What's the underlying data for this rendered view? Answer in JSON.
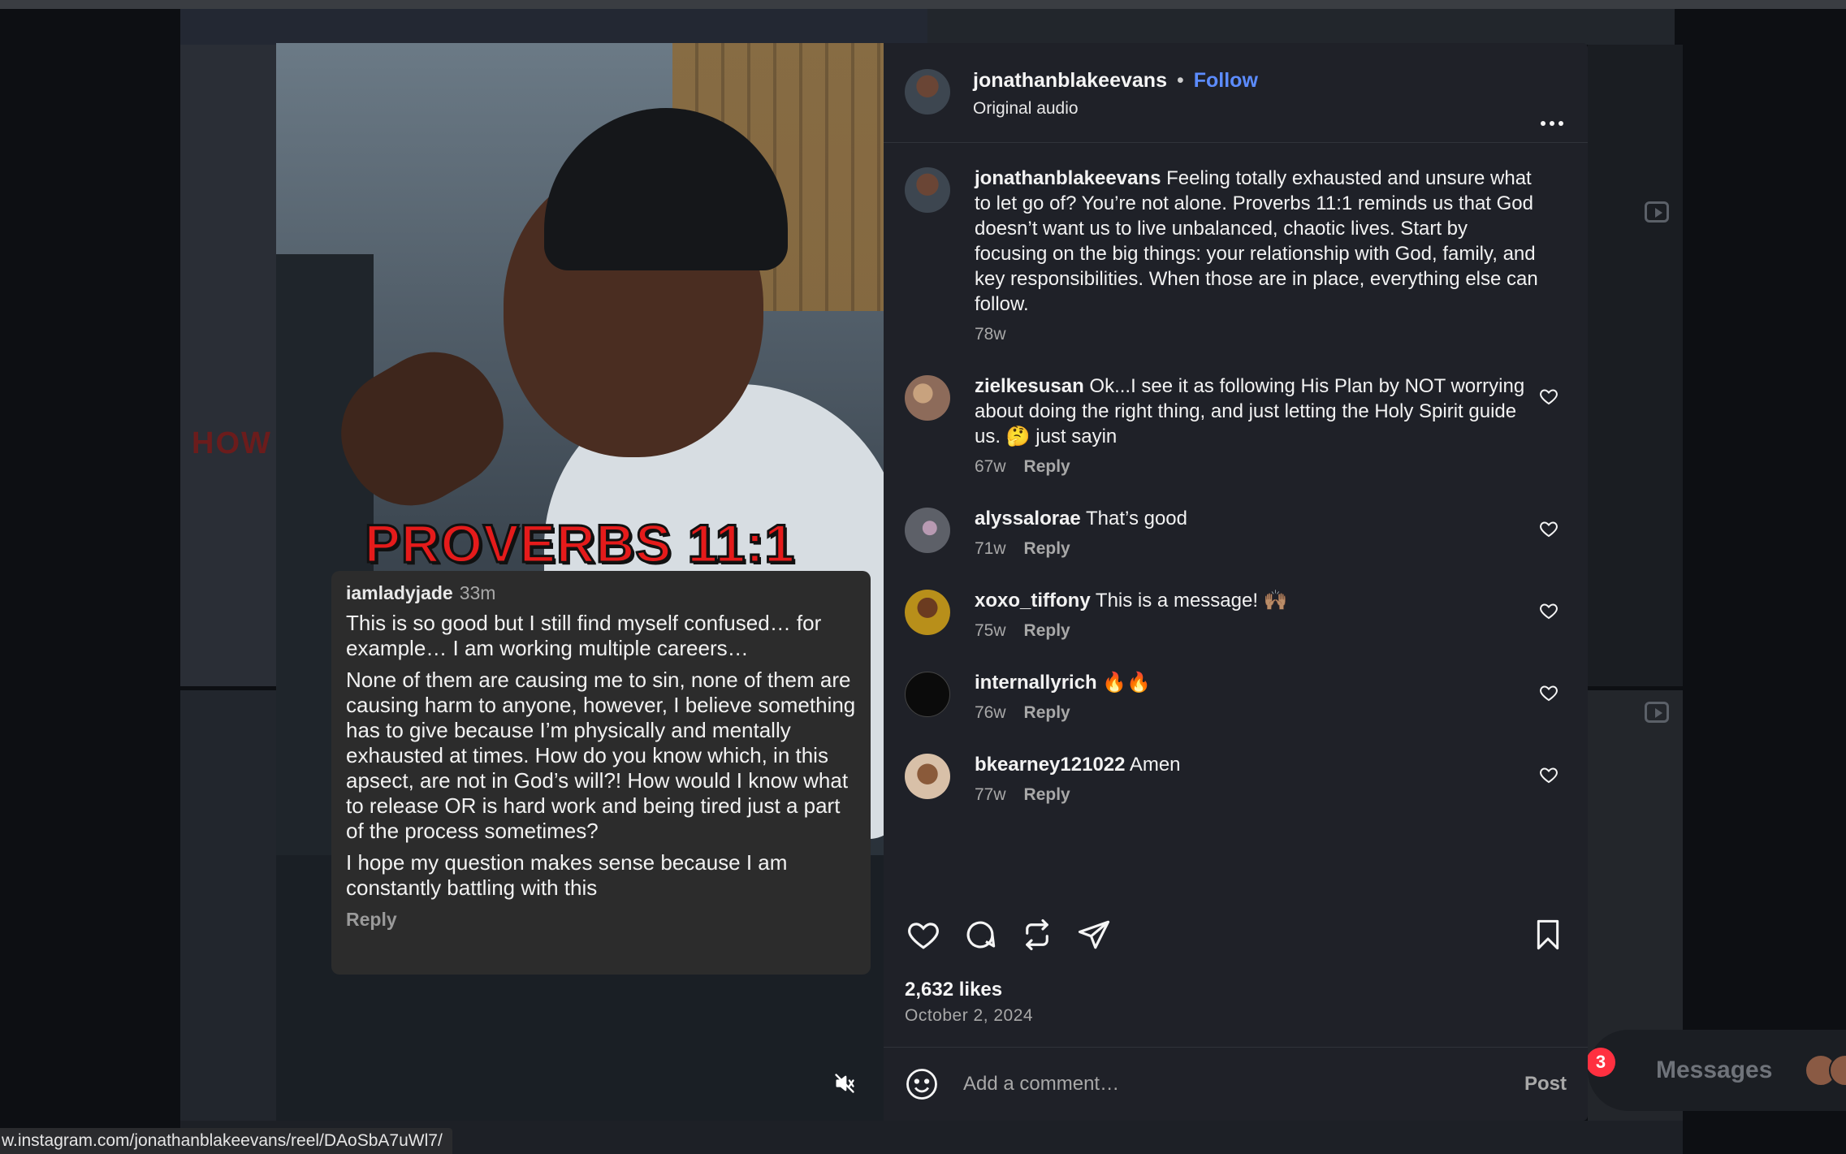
{
  "status_url": "w.instagram.com/jonathanblakeevans/reel/DAoSbA7uWl7/",
  "background": {
    "overlay_text": "HOW"
  },
  "messages": {
    "label": "Messages",
    "badge": "3"
  },
  "video": {
    "overlay_title": "PROVERBS 11:1",
    "pinned_comment": {
      "user": "iamladyjade",
      "time": "33m",
      "paragraphs": [
        "This is so good but I still find myself confused… for example… I am working multiple careers…",
        "None of them are causing me to sin, none of them are causing harm to anyone, however, I believe something has to give because I’m physically and mentally exhausted at times.  How do you know which, in this apsect, are not in God’s will?! How would I know what to release OR is hard work and being tired just a part of the process sometimes?",
        "I hope my question makes sense because I am constantly battling with this"
      ],
      "reply_label": "Reply"
    }
  },
  "post": {
    "author": "jonathanblakeevans",
    "follow_label": "Follow",
    "audio": "Original audio",
    "caption": {
      "user": "jonathanblakeevans",
      "text": "Feeling totally exhausted and unsure what to let go of? You’re not alone. Proverbs 11:1 reminds us that God doesn’t want us to live unbalanced, chaotic lives. Start by focusing on the big things: your relationship with God, family, and key responsibilities. When those are in place, everything else can follow.",
      "time": "78w"
    },
    "comments": [
      {
        "user": "zielkesusan",
        "text": "Ok...I see it as following His Plan by NOT worrying about doing the right thing, and just letting the Holy Spirit guide us. 🤔 just sayin",
        "time": "67w",
        "reply": "Reply"
      },
      {
        "user": "alyssalorae",
        "text": "That’s good",
        "time": "71w",
        "reply": "Reply"
      },
      {
        "user": "xoxo_tiffony",
        "text": "This is a message! 🙌🏽",
        "time": "75w",
        "reply": "Reply"
      },
      {
        "user": "internallyrich",
        "text": "🔥🔥",
        "time": "76w",
        "reply": "Reply"
      },
      {
        "user": "bkearney121022",
        "text": "Amen",
        "time": "77w",
        "reply": "Reply"
      }
    ],
    "likes": "2,632 likes",
    "date": "October 2, 2024",
    "add_comment_placeholder": "Add a comment…",
    "post_label": "Post"
  }
}
